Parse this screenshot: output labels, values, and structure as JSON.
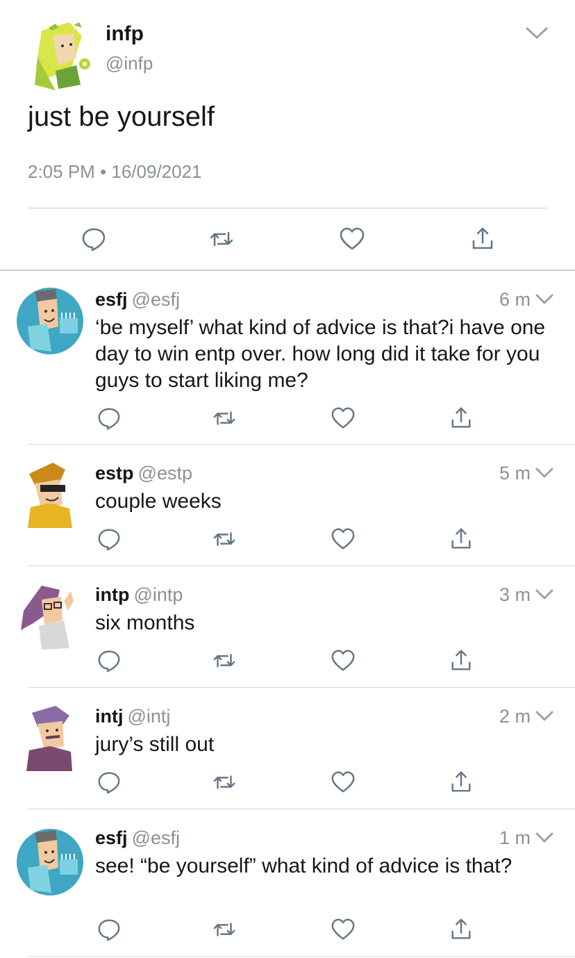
{
  "main_tweet": {
    "name": "infp",
    "handle": "@infp",
    "text": "just be yourself",
    "meta": "2:05 PM • 16/09/2021",
    "avatar_icon": "infp-avatar-icon"
  },
  "replies": [
    {
      "name": "esfj",
      "handle": "@esfj",
      "time": "6 m",
      "text": "‘be myself’ what kind of advice is that?i have one day to win entp over. how long did it take for you guys to start liking me?"
    },
    {
      "name": "estp",
      "handle": "@estp",
      "time": "5 m",
      "text": "couple weeks"
    },
    {
      "name": "intp",
      "handle": "@intp",
      "time": "3 m",
      "text": "six months"
    },
    {
      "name": "intj",
      "handle": "@intj",
      "time": "2 m",
      "text": "jury’s still out"
    },
    {
      "name": "esfj",
      "handle": "@esfj",
      "time": "1 m",
      "text": "see! “be yourself” what kind of advice is that?"
    }
  ],
  "colors": {
    "text": "#14171a",
    "muted": "#8a9198",
    "divider": "#c8ccd0"
  },
  "icons": [
    "reply-icon",
    "retweet-icon",
    "like-icon",
    "share-icon",
    "chevron-down-icon"
  ]
}
